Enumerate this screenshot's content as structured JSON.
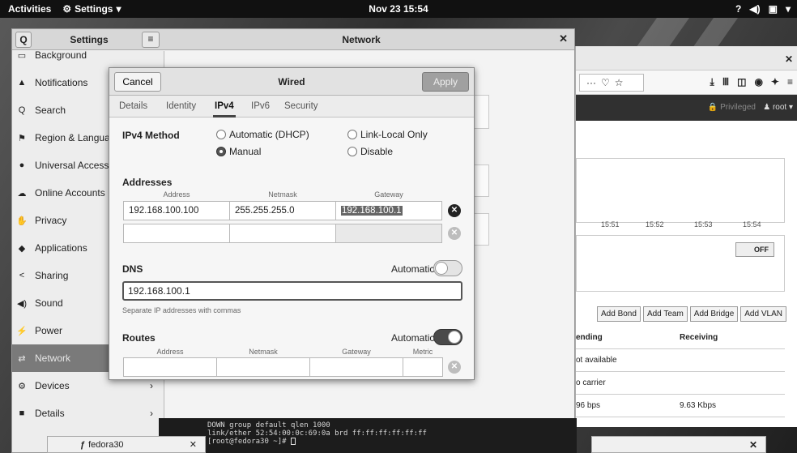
{
  "topbar": {
    "activities": "Activities",
    "app_menu": "Settings",
    "clock": "Nov 23  15:54",
    "tray_icons": [
      "question-icon",
      "volume-icon",
      "battery-icon",
      "chevron-down-icon"
    ]
  },
  "settings_window": {
    "title": "Settings",
    "panel_title": "Network",
    "sidebar": [
      {
        "label": "Background",
        "icon": "background-icon"
      },
      {
        "label": "Notifications",
        "icon": "bell-icon"
      },
      {
        "label": "Search",
        "icon": "search-icon"
      },
      {
        "label": "Region & Language",
        "icon": "flag-icon"
      },
      {
        "label": "Universal Access",
        "icon": "accessibility-icon"
      },
      {
        "label": "Online Accounts",
        "icon": "cloud-icon"
      },
      {
        "label": "Privacy",
        "icon": "hand-icon"
      },
      {
        "label": "Applications",
        "icon": "apps-icon"
      },
      {
        "label": "Sharing",
        "icon": "share-icon"
      },
      {
        "label": "Sound",
        "icon": "speaker-icon"
      },
      {
        "label": "Power",
        "icon": "power-icon"
      },
      {
        "label": "Network",
        "icon": "network-icon",
        "active": true
      },
      {
        "label": "Devices",
        "icon": "devices-icon"
      },
      {
        "label": "Details",
        "icon": "details-icon"
      }
    ]
  },
  "dialog": {
    "cancel": "Cancel",
    "title": "Wired",
    "apply": "Apply",
    "tabs": [
      "Details",
      "Identity",
      "IPv4",
      "IPv6",
      "Security"
    ],
    "active_tab": "IPv4",
    "ipv4_method_label": "IPv4 Method",
    "methods": {
      "automatic": "Automatic (DHCP)",
      "link_local": "Link-Local Only",
      "manual": "Manual",
      "disable": "Disable",
      "selected": "Manual"
    },
    "addresses_label": "Addresses",
    "address_cols": {
      "address": "Address",
      "netmask": "Netmask",
      "gateway": "Gateway"
    },
    "address_rows": [
      {
        "address": "192.168.100.100",
        "netmask": "255.255.255.0",
        "gateway": "192.168.100.1"
      },
      {
        "address": "",
        "netmask": "",
        "gateway": ""
      }
    ],
    "dns_label": "DNS",
    "dns_automatic_label": "Automatic",
    "dns_automatic": false,
    "dns_value": "192.168.100.1",
    "dns_hint": "Separate IP addresses with commas",
    "routes_label": "Routes",
    "routes_automatic_label": "Automatic",
    "routes_automatic": true,
    "route_cols": {
      "address": "Address",
      "netmask": "Netmask",
      "gateway": "Gateway",
      "metric": "Metric"
    }
  },
  "browser": {
    "privileged": "Privileged",
    "user": "root",
    "graph_ticks": [
      "15:51",
      "15:52",
      "15:53",
      "15:54"
    ],
    "off_label": "OFF",
    "buttons": [
      "Add Bond",
      "Add Team",
      "Add Bridge",
      "Add VLAN"
    ],
    "table_headers": [
      "ending",
      "Receiving"
    ],
    "table_rows": [
      {
        "sending": "ot available",
        "receiving": ""
      },
      {
        "sending": "o carrier",
        "receiving": ""
      },
      {
        "sending": "96 bps",
        "receiving": "9.63 Kbps"
      }
    ]
  },
  "terminal": {
    "lines": [
      "DOWN group default qlen 1000",
      "    link/ether 52:54:00:0c:69:0a brd ff:ff:ff:ff:ff:ff",
      "[root@fedora30 ~]# "
    ]
  },
  "taskbar": {
    "left_label": "fedora30"
  }
}
